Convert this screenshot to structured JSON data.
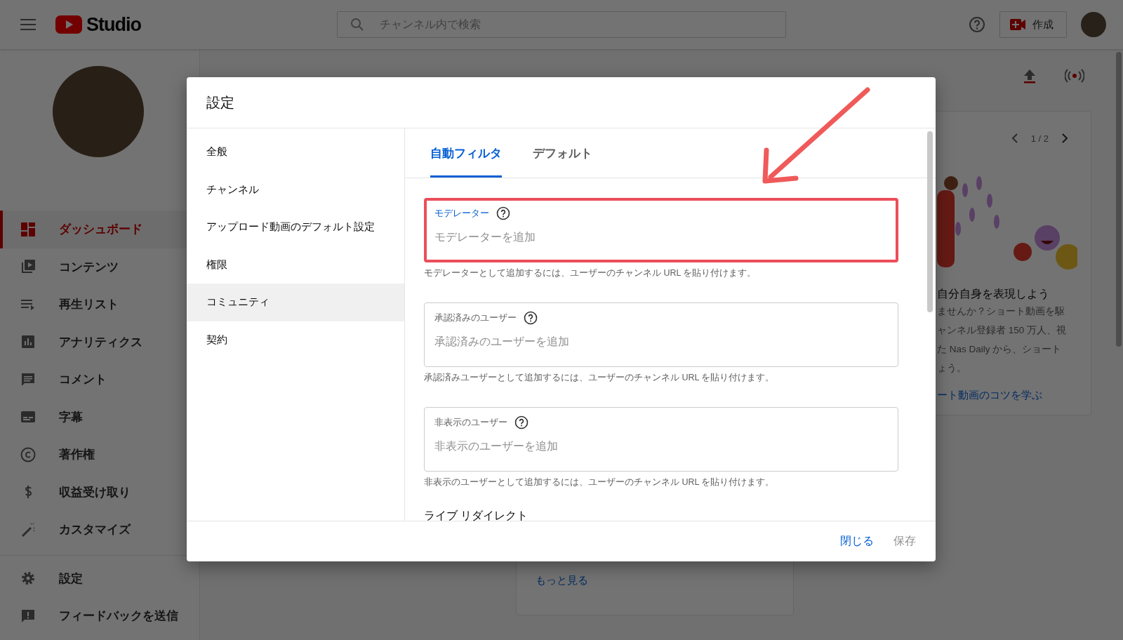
{
  "topbar": {
    "logo_text": "Studio",
    "search": {
      "placeholder": "チャンネル内で検索"
    },
    "create_button": "作成"
  },
  "sidebar": {
    "items": [
      {
        "label": "ダッシュボード",
        "selected": true
      },
      {
        "label": "コンテンツ",
        "selected": false
      },
      {
        "label": "再生リスト",
        "selected": false
      },
      {
        "label": "アナリティクス",
        "selected": false
      },
      {
        "label": "コメント",
        "selected": false
      },
      {
        "label": "字幕",
        "selected": false
      },
      {
        "label": "著作権",
        "selected": false
      },
      {
        "label": "収益受け取り",
        "selected": false
      },
      {
        "label": "カスタマイズ",
        "selected": false
      }
    ],
    "footer_items": [
      {
        "label": "設定",
        "selected": false
      },
      {
        "label": "フィードバックを送信",
        "selected": false
      }
    ]
  },
  "main": {
    "carousel": {
      "page": "1 / 2"
    },
    "promo": {
      "title": "自分自身を表現しよう",
      "lines": [
        "ませんか？ショート動画を駆",
        "ャンネル登録者 150 万人、視",
        "た Nas Daily から、ショート",
        "ょう。"
      ],
      "link": "ート動画のコツを学ぶ"
    },
    "more_link": "もっと見る"
  },
  "dialog": {
    "title": "設定",
    "nav": [
      {
        "label": "全般",
        "selected": false
      },
      {
        "label": "チャンネル",
        "selected": false
      },
      {
        "label": "アップロード動画のデフォルト設定",
        "selected": false
      },
      {
        "label": "権限",
        "selected": false
      },
      {
        "label": "コミュニティ",
        "selected": true
      },
      {
        "label": "契約",
        "selected": false
      }
    ],
    "tabs": [
      {
        "label": "自動フィルタ",
        "selected": true
      },
      {
        "label": "デフォルト",
        "selected": false
      }
    ],
    "fields": [
      {
        "label": "モデレーター",
        "placeholder": "モデレーターを追加",
        "help": "モデレーターとして追加するには、ユーザーのチャンネル URL を貼り付けます。",
        "focused": true,
        "highlighted": true
      },
      {
        "label": "承認済みのユーザー",
        "placeholder": "承認済みのユーザーを追加",
        "help": "承認済みユーザーとして追加するには、ユーザーのチャンネル URL を貼り付けます。",
        "focused": false,
        "highlighted": false
      },
      {
        "label": "非表示のユーザー",
        "placeholder": "非表示のユーザーを追加",
        "help": "非表示のユーザーとして追加するには、ユーザーのチャンネル URL を貼り付けます。",
        "focused": false,
        "highlighted": false
      }
    ],
    "section_heading": "ライブ リダイレクト",
    "buttons": [
      {
        "label": "閉じる",
        "disabled": false
      },
      {
        "label": "保存",
        "disabled": true
      }
    ]
  }
}
